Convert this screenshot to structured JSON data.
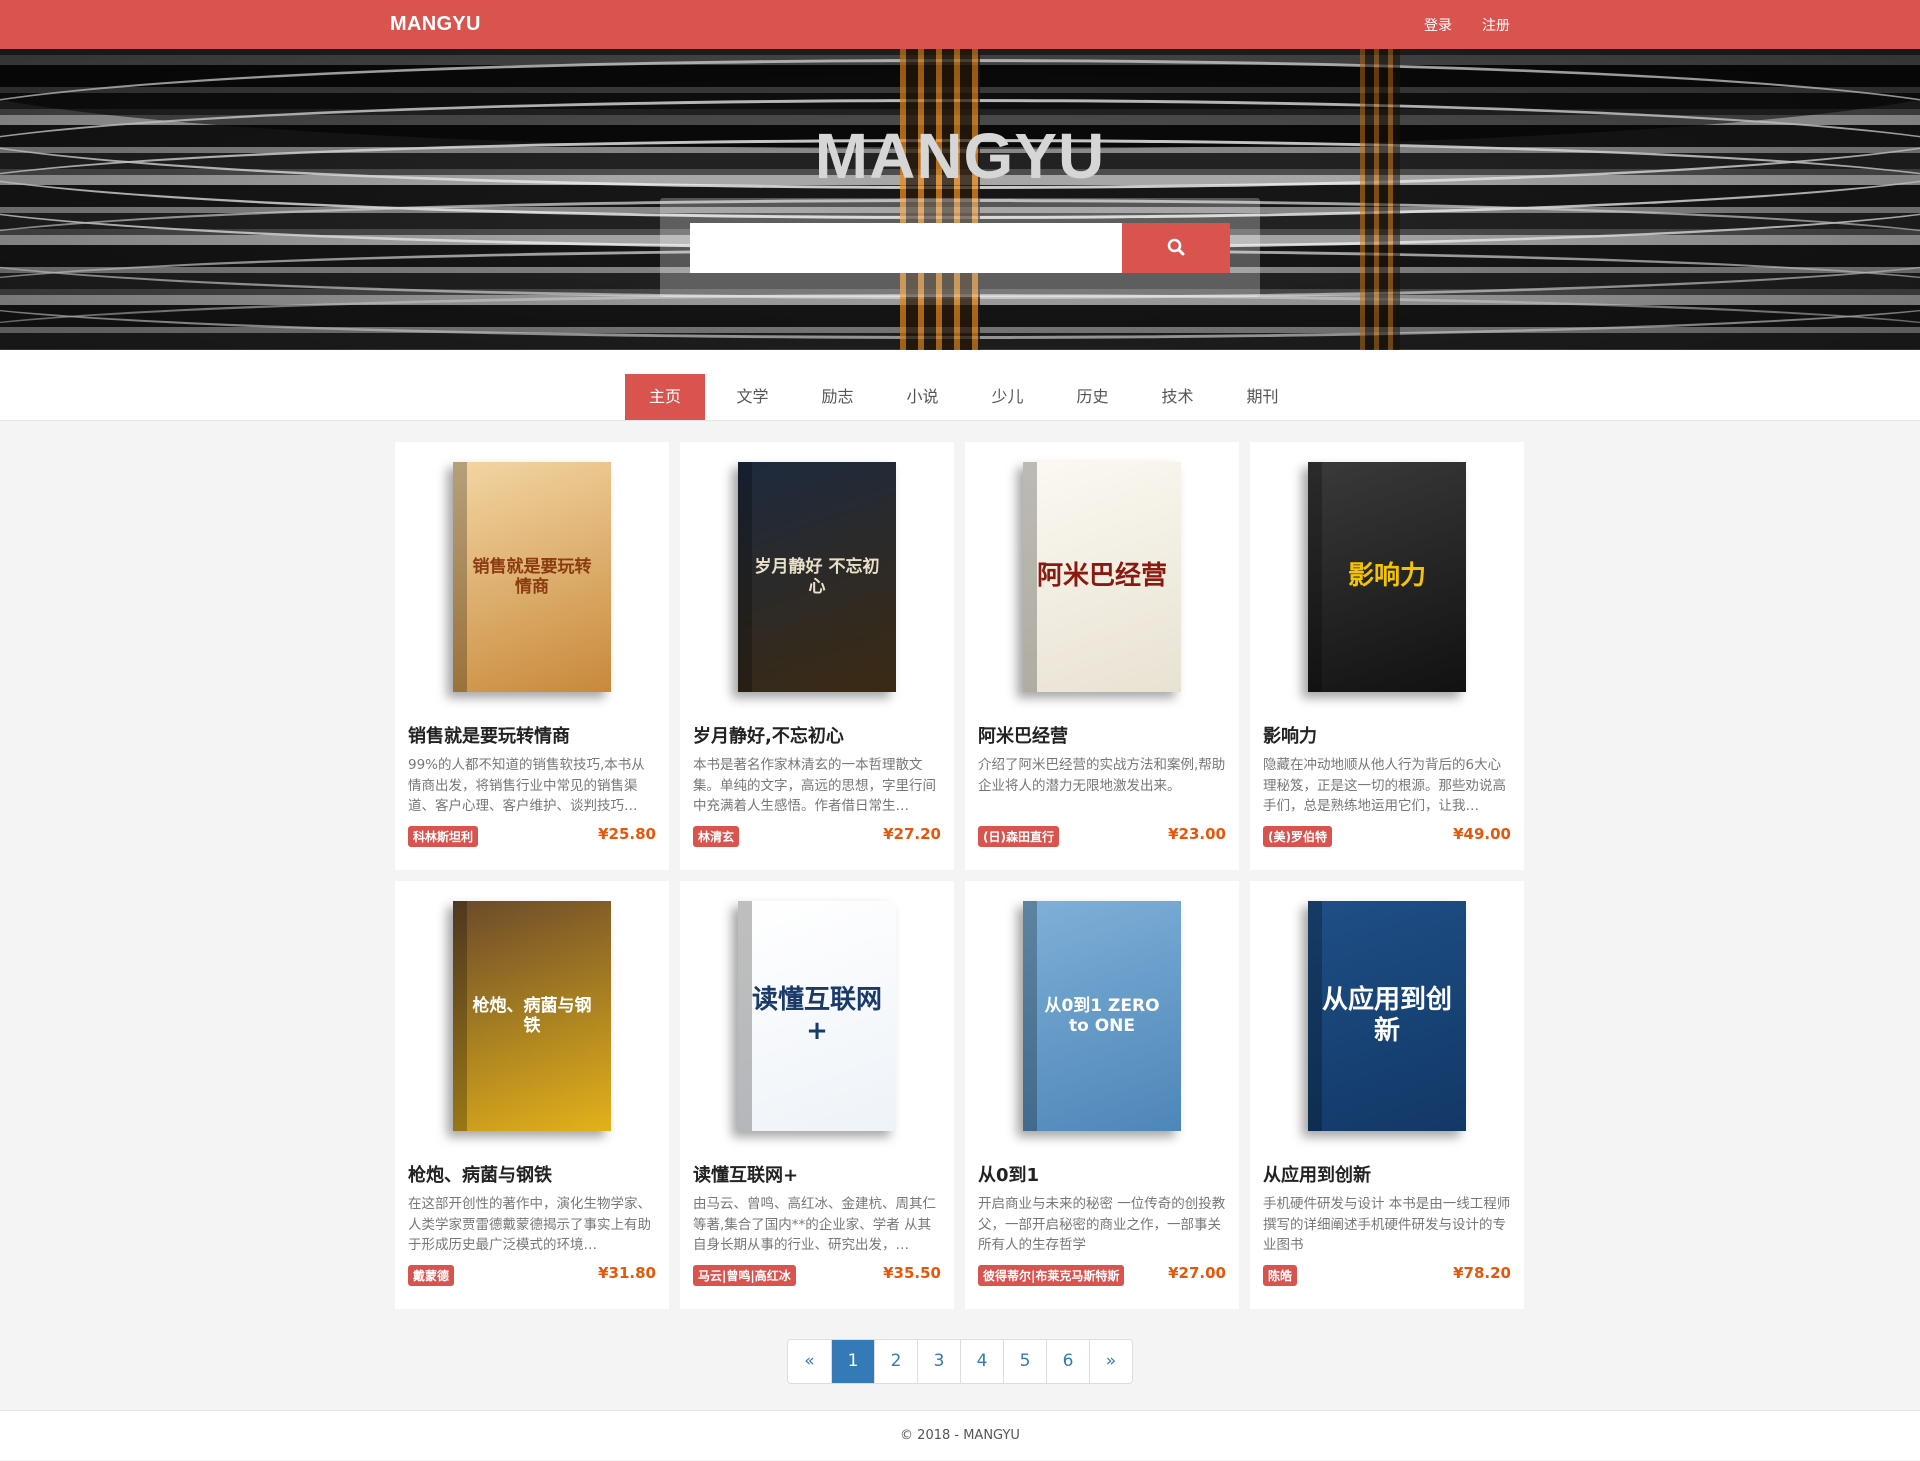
{
  "header": {
    "brand": "MANGYU",
    "login": "登录",
    "register": "注册"
  },
  "hero": {
    "title": "MANGYU",
    "search_value": "",
    "search_icon": "search-icon"
  },
  "tabs": [
    "主页",
    "文学",
    "励志",
    "小说",
    "少儿",
    "历史",
    "技术",
    "期刊"
  ],
  "books": [
    {
      "cover_text": "销售就是要玩转情商",
      "title": "销售就是要玩转情商",
      "desc": "99%的人都不知道的销售软技巧,本书从情商出发，将销售行业中常见的销售渠道、客户心理、客户维护、谈判技巧…",
      "author": "科林斯坦利",
      "price": "¥25.80",
      "colors": [
        "#f3d6a4",
        "#c8893a"
      ],
      "text_color": "#8a3c10"
    },
    {
      "cover_text": "岁月静好 不忘初心",
      "title": "岁月静好,不忘初心",
      "desc": "本书是著名作家林清玄的一本哲理散文集。单纯的文字，高远的思想，字里行间中充满着人生感悟。作者借日常生…",
      "author": "林清玄",
      "price": "¥27.20",
      "colors": [
        "#1d2a3e",
        "#3b2a12"
      ],
      "text_color": "#e8e0c8"
    },
    {
      "cover_text": "阿米巴经营",
      "title": "阿米巴经营",
      "desc": "介绍了阿米巴经营的实战方法和案例,帮助企业将人的潜力无限地激发出来。",
      "author": "(日)森田直行",
      "price": "¥23.00",
      "colors": [
        "#fbf9f2",
        "#e8e2d2"
      ],
      "text_color": "#8a1a10"
    },
    {
      "cover_text": "影响力",
      "title": "影响力",
      "desc": "隐藏在冲动地顺从他人行为背后的6大心理秘笈，正是这一切的根源。那些劝说高手们，总是熟练地运用它们，让我…",
      "author": "(美)罗伯特",
      "price": "¥49.00",
      "colors": [
        "#3a3a3a",
        "#111111"
      ],
      "text_color": "#f5c400"
    },
    {
      "cover_text": "枪炮、病菌与钢铁",
      "title": "枪炮、病菌与钢铁",
      "desc": "在这部开创性的著作中，演化生物学家、人类学家贾雷德戴蒙德揭示了事实上有助于形成历史最广泛模式的环境…",
      "author": "戴蒙德",
      "price": "¥31.80",
      "colors": [
        "#6a4a2a",
        "#e3b21a"
      ],
      "text_color": "#ffffff"
    },
    {
      "cover_text": "读懂互联网+",
      "title": "读懂互联网+",
      "desc": "由马云、曾鸣、高红冰、金建杭、周其仁等著,集合了国内**的企业家、学者 从其自身长期从事的行业、研究出发，…",
      "author": "马云|曾鸣|高红冰",
      "price": "¥35.50",
      "colors": [
        "#ffffff",
        "#eef3f8"
      ],
      "text_color": "#1a3a6a"
    },
    {
      "cover_text": "从0到1 ZERO to ONE",
      "title": "从0到1",
      "desc": "开启商业与未来的秘密 一位传奇的创投教父，一部开启秘密的商业之作，一部事关所有人的生存哲学",
      "author": "彼得蒂尔|布莱克马斯特斯",
      "price": "¥27.00",
      "colors": [
        "#7fb0d8",
        "#4d86b8"
      ],
      "text_color": "#ffffff"
    },
    {
      "cover_text": "从应用到创新",
      "title": "从应用到创新",
      "desc": "手机硬件研发与设计 本书是由一线工程师撰写的详细阐述手机硬件研发与设计的专业图书",
      "author": "陈皓",
      "price": "¥78.20",
      "colors": [
        "#1e4f86",
        "#123866"
      ],
      "text_color": "#ffffff"
    }
  ],
  "pagination": [
    "«",
    "1",
    "2",
    "3",
    "4",
    "5",
    "6",
    "»"
  ],
  "pagination_active": "1",
  "footer": "© 2018 - MANGYU",
  "colors": {
    "accent": "#d9534f",
    "price": "#e8560a",
    "link": "#337ab7"
  }
}
